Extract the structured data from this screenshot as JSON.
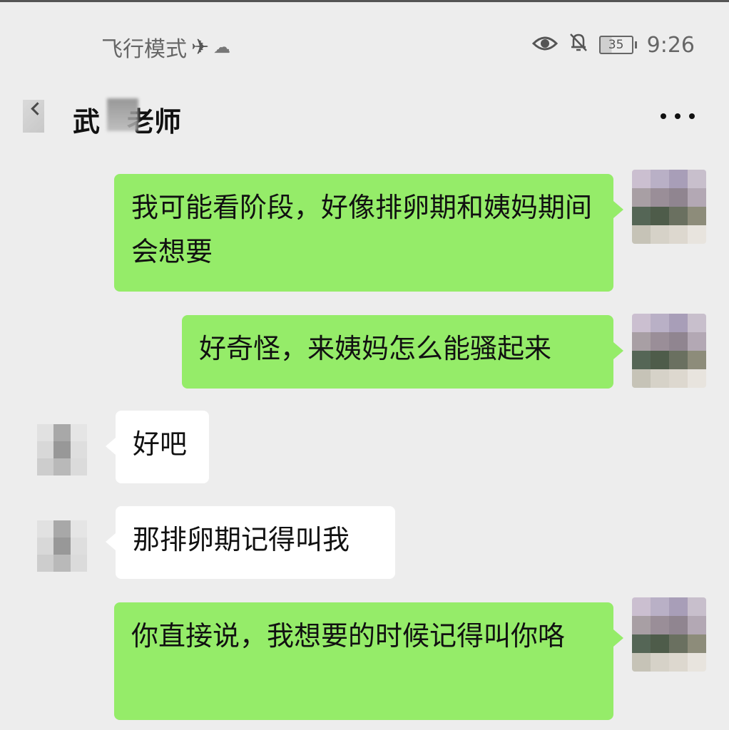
{
  "status_bar": {
    "mode_label": "飞行模式",
    "airplane_glyph": "✈",
    "cloud_glyph": "☁",
    "eye_glyph": "👁",
    "bell_glyph": "🔕",
    "battery_level": "35",
    "time": "9:26"
  },
  "header": {
    "title": "武　老师",
    "more_label": "more-icon"
  },
  "messages": [
    {
      "sender": "self",
      "text": "我可能看阶段，好像排卵期和姨妈期间会想要"
    },
    {
      "sender": "self",
      "text": "好奇怪，来姨妈怎么能骚起来"
    },
    {
      "sender": "other",
      "text": "好吧"
    },
    {
      "sender": "other",
      "text": "那排卵期记得叫我"
    },
    {
      "sender": "self",
      "text": "你直接说，我想要的时候记得叫你咯"
    }
  ],
  "colors": {
    "background": "#ededed",
    "sent_bubble": "#95ec69",
    "received_bubble": "#ffffff"
  }
}
